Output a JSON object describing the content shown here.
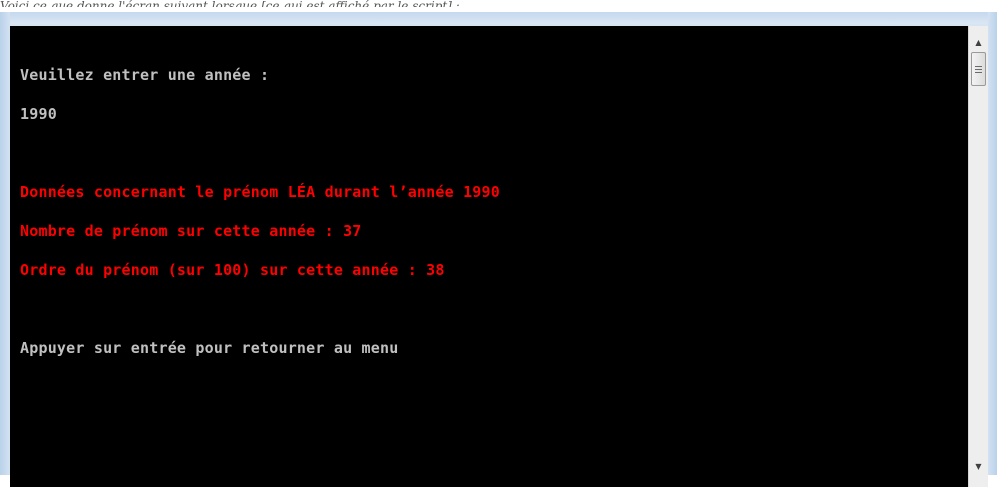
{
  "caption": "Voici ce que donne l'écran suivant lorsque [ce qui est affiché par le script] :",
  "console": {
    "lines": [
      {
        "text": "Veuillez entrer une année :",
        "color": "gray"
      },
      {
        "text": "1990",
        "color": "gray"
      },
      {
        "text": "",
        "color": "gray"
      },
      {
        "text": "Données concernant le prénom LÉA durant l’année 1990",
        "color": "red"
      },
      {
        "text": "Nombre de prénom sur cette année : 37",
        "color": "red"
      },
      {
        "text": "Ordre du prénom (sur 100) sur cette année : 38",
        "color": "red"
      },
      {
        "text": "",
        "color": "gray"
      },
      {
        "text": "Appuyer sur entrée pour retourner au menu",
        "color": "gray"
      }
    ],
    "background": "#000000",
    "text_color_gray": "#c0c0c0",
    "text_color_red": "#ff0000"
  },
  "scrollbar": {
    "up_icon": "scroll-up-arrow-icon",
    "down_icon": "scroll-down-arrow-icon"
  }
}
